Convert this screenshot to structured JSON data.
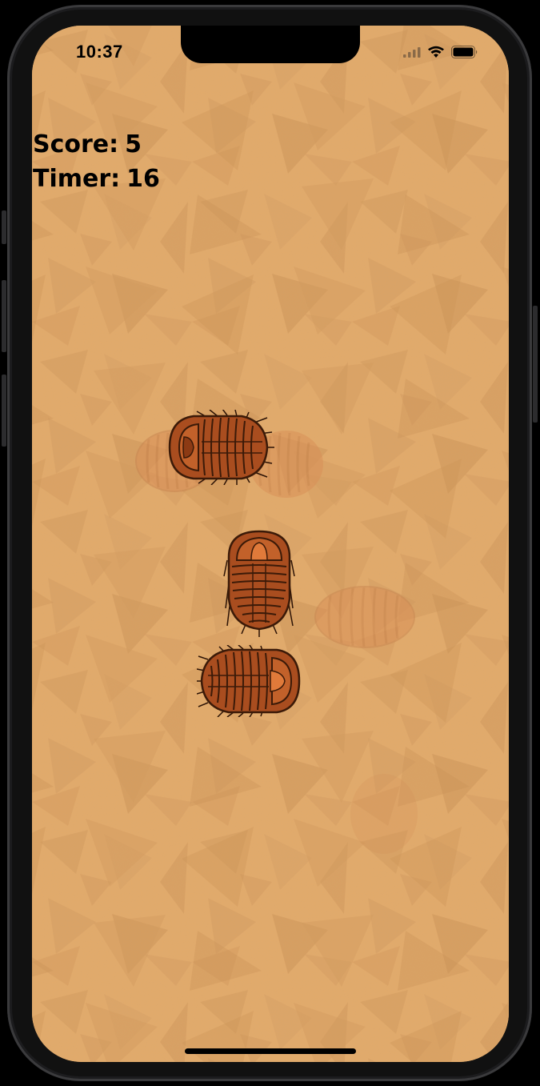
{
  "status_bar": {
    "time": "10:37",
    "icons": [
      "cellular-signal-icon",
      "wifi-icon",
      "battery-icon"
    ]
  },
  "hud": {
    "score_label": "Score:",
    "score_value": "5",
    "timer_label": "Timer:",
    "timer_value": "16"
  },
  "colors": {
    "background": "#e3aa6a",
    "trilobite_shell": "#a94d1f",
    "trilobite_outline": "#3b1a08",
    "fossil_imprint": "#d98f57",
    "text": "#000000"
  },
  "board": {
    "trilobites": [
      {
        "id": "trilobite-1",
        "facing": "right",
        "state": "live"
      },
      {
        "id": "trilobite-2",
        "facing": "down",
        "state": "live"
      },
      {
        "id": "trilobite-3",
        "facing": "left",
        "state": "live"
      }
    ],
    "fossils": [
      {
        "id": "fossil-imprint-1",
        "state": "fading"
      },
      {
        "id": "fossil-imprint-2",
        "state": "fading"
      },
      {
        "id": "fossil-imprint-3",
        "state": "fading"
      },
      {
        "id": "fossil-imprint-4",
        "state": "faint"
      }
    ]
  }
}
